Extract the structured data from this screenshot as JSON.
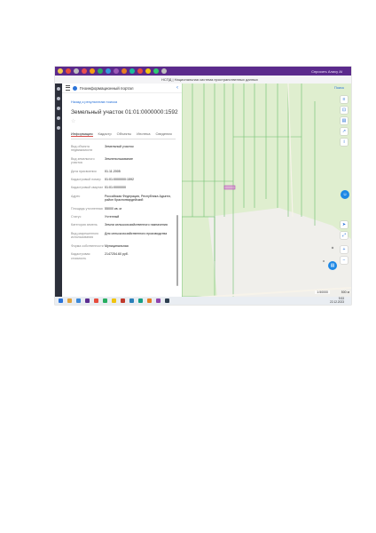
{
  "browser": {
    "url": "НСПД | Национальная система пространственных данных",
    "bookmark": "Спросить Алису AI",
    "tab_colors": [
      "#f2c94c",
      "#e74c3c",
      "#bdbdbd",
      "#e84f4f",
      "#f39c12",
      "#27ae60",
      "#3498db",
      "#9b59b6",
      "#e67e22",
      "#1abc9c",
      "#e74c3c",
      "#f1c40f",
      "#2ecc71",
      "#bdbdbd"
    ]
  },
  "portal": {
    "title": "Геоинформационный портал",
    "back_link": "Назад к результатам поиска",
    "heading": "Земельный участок 01:01:0000000:1592",
    "tabs": [
      "Информация",
      "Кадастр",
      "Объекты",
      "Ипотека",
      "Сведения"
    ],
    "active_tab": "Информация",
    "rows": [
      {
        "label": "Вид объекта недвижимости",
        "value": "Земельный участок"
      },
      {
        "label": "Вид земельного участка",
        "value": "Землепользование"
      },
      {
        "label": "Дата присвоения",
        "value": "01.11.2005"
      },
      {
        "label": "Кадастровый номер",
        "value": "01:01:0000000:1592"
      },
      {
        "label": "Кадастровый квартал",
        "value": "01:01:0000000"
      },
      {
        "label": "Адрес",
        "value": "Российская Федерация, Республика Адыгея, район Красногвардейский"
      },
      {
        "label": "Площадь уточненная",
        "value": "55000 кв. м"
      },
      {
        "label": "Статус",
        "value": "Учтенный"
      },
      {
        "label": "Категория земель",
        "value": "Земли сельскохозяйственного назначения"
      },
      {
        "label": "Вид разрешенного использования",
        "value": "Для сельскохозяйственного производства"
      },
      {
        "label": "Форма собственности",
        "value": "Муниципальная"
      },
      {
        "label": "Кадастровая стоимость",
        "value": "2147254.60 руб."
      }
    ]
  },
  "map": {
    "search": "Поиск",
    "scale_text": "1:50000",
    "scale_right": "500 м",
    "colors": {
      "base": "#dfeecf",
      "road": "#f7f3ea",
      "parcel": "#6cbf6c",
      "selected": "#d96bd9",
      "water": "#9fc9f0",
      "urban": "#f0efeb"
    }
  },
  "taskbar": {
    "time": "9:53",
    "date": "22.12.2023",
    "icons": [
      "#2a73d9",
      "#e1a33b",
      "#3d89d8",
      "#5c2d91",
      "#e74c3c",
      "#27ae60",
      "#f1c40f",
      "#c0392b",
      "#2980b9",
      "#16a085",
      "#e67e22",
      "#8e44ad",
      "#2c3e50"
    ]
  }
}
